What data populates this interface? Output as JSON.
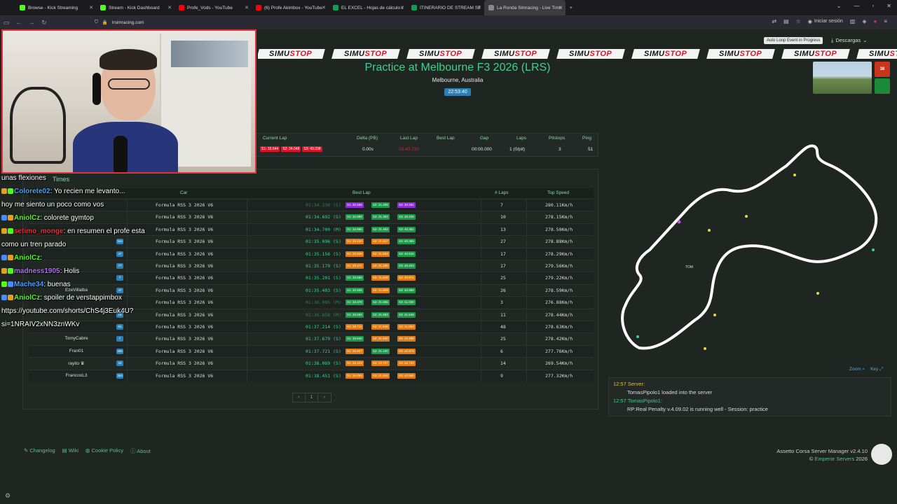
{
  "browser": {
    "tabs": [
      {
        "label": "Browse - Kick Streaming",
        "color": "#53fc18",
        "active": false
      },
      {
        "label": "Stream - Kick Dashboard",
        "color": "#53fc18",
        "active": false
      },
      {
        "label": "Profe_Vods - YouTube",
        "color": "#ff0000",
        "active": false
      },
      {
        "label": "(6) Profe Akimbox - YouTube",
        "color": "#ff0000",
        "active": false
      },
      {
        "label": "EL EXCEL - Hojas de cálculo de",
        "color": "#0f9d58",
        "active": false
      },
      {
        "label": "ITINERARIO DE STREAM SEMA",
        "color": "#0f9d58",
        "active": false
      },
      {
        "label": "La Ronda Simracing - Live Timing",
        "color": "#888888",
        "active": true
      }
    ],
    "url": "lrsimracing.com",
    "signin": "Iniciar sesión"
  },
  "page": {
    "sponsor_text_a": "SIMU",
    "sponsor_text_b": "STOP",
    "title": "Practice at Melbourne F3 2026 (LRS)",
    "location": "Melbourne, Australia",
    "clock": "22:53:40",
    "loop_badge": "Auto Loop Event in Progress",
    "downloads": "Descargas",
    "logo_small": "38"
  },
  "driver_panel": {
    "headers": {
      "current_lap": "Current Lap",
      "delta": "Delta (PB)",
      "last_lap": "Last Lap",
      "best_lap": "Best Lap",
      "gap": "Gap",
      "laps": "Laps",
      "pitstops": "Pitstops",
      "ping": "Ping"
    },
    "values": {
      "s1": "S1: 33.644",
      "s2": "S2: 24.048",
      "s3": "S3: 43.038",
      "delta": "0.00s",
      "last_lap": "03:40.730",
      "best_lap": "",
      "gap": "00:00.000",
      "laps": "1 (0/pit)",
      "pitstops": "3",
      "ping": "51"
    }
  },
  "board": {
    "section_label": "Times",
    "headers": {
      "car": "Car",
      "best_lap": "Best Lap",
      "laps": "# Laps",
      "top_speed": "Top Speed"
    },
    "rows": [
      {
        "name": "",
        "badge": "",
        "car": "Formula RSS 3 2026 V6",
        "lap": "01:34.230 (S)",
        "lapclass": "dim",
        "s1": "S1: 32.558",
        "s2": "S2: 21.465",
        "s3": "S3: 40.261",
        "c1": "#8a2fd1",
        "c2": "#1c9a4a",
        "c3": "#8a2fd1",
        "laps": "7",
        "speed": "280.11Km/h"
      },
      {
        "name": "",
        "badge": "",
        "car": "Formula RSS 3 2026 V6",
        "lap": "01:34.692 (S)",
        "lapclass": "",
        "s1": "S1: 32.888",
        "s2": "S2: 21.492",
        "s3": "S3: 40.436",
        "c1": "#1c9a4a",
        "c2": "#1c9a4a",
        "c3": "#1c9a4a",
        "laps": "10",
        "speed": "278.15Km/h"
      },
      {
        "name": "",
        "badge": "",
        "car": "Formula RSS 3 2026 V6",
        "lap": "01:34.700 (M)",
        "lapclass": "",
        "s1": "S1: 32.896",
        "s2": "S2: 21.482",
        "s3": "S3: 40.351",
        "c1": "#1c9a4a",
        "c2": "#1c9a4a",
        "c3": "#1c9a4a",
        "laps": "13",
        "speed": "278.50Km/h"
      },
      {
        "name": "",
        "badge": "344",
        "car": "Formula RSS 3 2026 V6",
        "lap": "01:35.096 (S)",
        "lapclass": "",
        "s1": "S1: 33.220",
        "s2": "S2: 21.517",
        "s3": "S3: 40.359",
        "c1": "#e07b12",
        "c2": "#e07b12",
        "c3": "#1c9a4a",
        "laps": "27",
        "speed": "278.88Km/h"
      },
      {
        "name": "",
        "badge": "47",
        "car": "Formula RSS 3 2026 V6",
        "lap": "01:35.156 (S)",
        "lapclass": "",
        "s1": "S1: 32.948",
        "s2": "S2: 21.593",
        "s3": "S3: 40.616",
        "c1": "#e07b12",
        "c2": "#e07b12",
        "c3": "#1c9a4a",
        "laps": "17",
        "speed": "278.29Km/h"
      },
      {
        "name": "",
        "badge": "77",
        "car": "Formula RSS 3 2026 V6",
        "lap": "01:35.179 (S)",
        "lapclass": "",
        "s1": "S1: 33.471",
        "s2": "S2: 21.285",
        "s3": "S3: 40.423",
        "c1": "#e07b12",
        "c2": "#e07b12",
        "c3": "#1c9a4a",
        "laps": "17",
        "speed": "279.56Km/h"
      },
      {
        "name": "",
        "badge": "7",
        "car": "Formula RSS 3 2026 V6",
        "lap": "01:35.201 (S)",
        "lapclass": "",
        "s1": "S1: 33.068",
        "s2": "S2: 21.626",
        "s3": "S3: 40.571",
        "c1": "#1c9a4a",
        "c2": "#e07b12",
        "c3": "#e07b12",
        "laps": "25",
        "speed": "279.22Km/h"
      },
      {
        "name": "EzeVillalba",
        "badge": "47",
        "car": "Formula RSS 3 2026 V6",
        "lap": "01:35.403 (S)",
        "lapclass": "",
        "s1": "S1: 32.935",
        "s2": "S2: 21.609",
        "s3": "S3: 40.869",
        "c1": "#1c9a4a",
        "c2": "#e07b12",
        "c3": "#1c9a4a",
        "laps": "26",
        "speed": "278.59Km/h"
      },
      {
        "name": "",
        "badge": "",
        "car": "Formula RSS 3 2026 V6",
        "lap": "01:36.095 (M)",
        "lapclass": "dim",
        "s1": "S1: 33.376",
        "s2": "S2: 21.685",
        "s3": "S3: 41.030",
        "c1": "#1c9a4a",
        "c2": "#1c9a4a",
        "c3": "#1c9a4a",
        "laps": "3",
        "speed": "276.88Km/h"
      },
      {
        "name": "",
        "badge": "19",
        "car": "Formula RSS 3 2026 V6",
        "lap": "01:36.858 (M)",
        "lapclass": "dim",
        "s1": "S1: 33.650",
        "s2": "S2: 21.693",
        "s3": "S3: 41.549",
        "c1": "#1c9a4a",
        "c2": "#1c9a4a",
        "c3": "#1c9a4a",
        "laps": "11",
        "speed": "278.44Km/h"
      },
      {
        "name": "",
        "badge": "91",
        "car": "Formula RSS 3 2026 V6",
        "lap": "01:37.214 (S)",
        "lapclass": "",
        "s1": "S1: 33.711",
        "s2": "S2: 21.636",
        "s3": "S3: 41.863",
        "c1": "#e07b12",
        "c2": "#e07b12",
        "c3": "#e07b12",
        "laps": "48",
        "speed": "278.63Km/h"
      },
      {
        "name": "TomyCabre",
        "badge": "7",
        "car": "Formula RSS 3 2026 V6",
        "lap": "01:37.679 (S)",
        "lapclass": "",
        "s1": "S1: 33.640",
        "s2": "S2: 21.640",
        "s3": "S3: 42.409",
        "c1": "#1c9a4a",
        "c2": "#e07b12",
        "c3": "#e07b12",
        "laps": "25",
        "speed": "278.42Km/h"
      },
      {
        "name": "Fran01",
        "badge": "306",
        "car": "Formula RSS 3 2026 V6",
        "lap": "01:37.721 (S)",
        "lapclass": "",
        "s1": "S1: 33.947",
        "s2": "S2: 21.100",
        "s3": "S3: 42.674",
        "c1": "#e07b12",
        "c2": "#1c9a4a",
        "c3": "#e07b12",
        "laps": "6",
        "speed": "277.76Km/h"
      },
      {
        "name": "rayito ♛",
        "badge": "33",
        "car": "Formula RSS 3 2026 V6",
        "lap": "01:38.069 (S)",
        "lapclass": "",
        "s1": "S1: 32.434",
        "s2": "S2: 22.707",
        "s3": "S3: 42.720",
        "c1": "#e07b12",
        "c2": "#e07b12",
        "c3": "#e07b12",
        "laps": "14",
        "speed": "269.54Km/h"
      },
      {
        "name": "FrancooL3",
        "badge": "363",
        "car": "Formula RSS 3 2026 V6",
        "lap": "01:38.451 (S)",
        "lapclass": "",
        "s1": "S1: 34.095",
        "s2": "S2: 21.916",
        "s3": "S3: 42.550",
        "c1": "#e07b12",
        "c2": "#e07b12",
        "c3": "#e07b12",
        "laps": "9",
        "speed": "277.32Km/h"
      }
    ],
    "pager": {
      "prev": "‹",
      "page": "1",
      "next": "›"
    }
  },
  "map": {
    "marker_label": "TOM",
    "zoom": "Zoom",
    "key": "Key"
  },
  "server_chat": [
    {
      "time": "12:57",
      "who": "Server:",
      "who_color": "#e0c040",
      "msg": "TomasPipolo1 loaded into the server"
    },
    {
      "time": "12:57",
      "who": "TomasPipolo1:",
      "who_color": "#4fc48c",
      "msg": "RP:Real Penalty v.4.09.02 is running well - Session: practice"
    }
  ],
  "footer": {
    "links": [
      "Changelog",
      "Wiki",
      "Cookie Policy",
      "About"
    ],
    "manager": "Assetto Corsa Server Manager v2.4.10",
    "copyright_prefix": "© ",
    "company": "Emperor Servers",
    "year": " 2026"
  },
  "stream_chat": [
    {
      "user": "",
      "user_color": "#ffffff",
      "text": "unas flexiones"
    },
    {
      "user": "Colorete02",
      "user_color": "#4aa0ff",
      "text": ": Yo recien me levanto..."
    },
    {
      "user": "",
      "user_color": "#ffffff",
      "text": "hoy me siento un poco como vos"
    },
    {
      "user": "AniolCz",
      "user_color": "#53fc18",
      "text": ": colorete gymtop"
    },
    {
      "user": "setimo_monge",
      "user_color": "#e0313c",
      "text": ": en resumen el profe esta"
    },
    {
      "user": "",
      "user_color": "#ffffff",
      "text": "como un tren parado"
    },
    {
      "user": "AniolCz",
      "user_color": "#53fc18",
      "text": ":"
    },
    {
      "user": "madness1905",
      "user_color": "#b36bff",
      "text": ": Holis"
    },
    {
      "user": "Mache34",
      "user_color": "#4aa0ff",
      "text": ": buenas"
    },
    {
      "user": "AniolCz",
      "user_color": "#53fc18",
      "text": ": spoiler de verstappimbox"
    },
    {
      "user": "",
      "user_color": "#ffffff",
      "text": "https://youtube.com/shorts/ChS4j3Euk4U?"
    },
    {
      "user": "",
      "user_color": "#ffffff",
      "text": "si=1NRAIV2xNN3znWKv"
    }
  ]
}
